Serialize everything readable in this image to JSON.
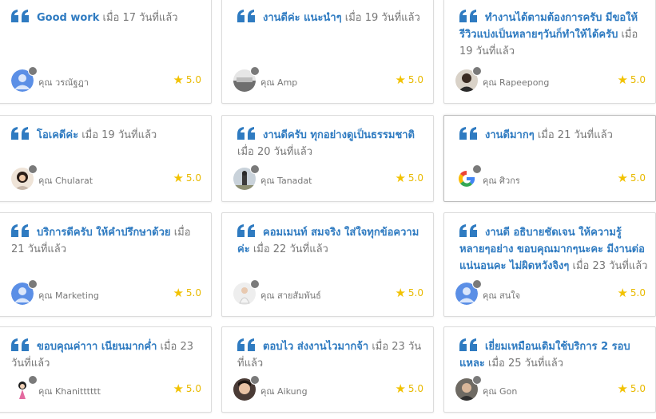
{
  "colors": {
    "accent": "#2f7bc1",
    "star": "#f2c200",
    "text": "#757575"
  },
  "reviews": [
    {
      "title": "Good work",
      "ago": "เมื่อ 17 วันที่แล้ว",
      "name": "คุณ วรณัฐฎา",
      "rating": "5.0",
      "avatar_icon": "person-avatar-icon"
    },
    {
      "title": "งานดีค่ะ แนะนำๆ",
      "ago": "เมื่อ 19 วันที่แล้ว",
      "name": "คุณ Amp",
      "rating": "5.0",
      "avatar_icon": "photo-avatar-icon"
    },
    {
      "title": "ทำงานได้ตามต้องการครับ มีขอให้รีวิวแบ่งเป็นหลายๆวันก็ทำให้ได้ครับ",
      "ago": "เมื่อ 19 วันที่แล้ว",
      "name": "คุณ Rapeepong",
      "rating": "5.0",
      "avatar_icon": "photo-avatar-icon"
    },
    {
      "title": "โอเคดีค่ะ",
      "ago": "เมื่อ 19 วันที่แล้ว",
      "name": "คุณ Chularat",
      "rating": "5.0",
      "avatar_icon": "photo-avatar-icon"
    },
    {
      "title": "งานดีครับ ทุกอย่างดูเป็นธรรมชาติ",
      "ago": "เมื่อ 20 วันที่แล้ว",
      "name": "คุณ Tanadat",
      "rating": "5.0",
      "avatar_icon": "photo-avatar-icon"
    },
    {
      "title": "งานดีมากๆ",
      "ago": "เมื่อ 21 วันที่แล้ว",
      "name": "คุณ ศิวกร",
      "rating": "5.0",
      "avatar_icon": "google-avatar-icon"
    },
    {
      "title": "บริการดีครับ ให้คำปรึกษาด้วย",
      "ago": "เมื่อ 21 วันที่แล้ว",
      "name": "คุณ Marketing",
      "rating": "5.0",
      "avatar_icon": "person-avatar-icon"
    },
    {
      "title": "คอมเมนท์ สมจริง ใส่ใจทุกข้อความค่ะ",
      "ago": "เมื่อ 22 วันที่แล้ว",
      "name": "คุณ สายสัมพันธ์",
      "rating": "5.0",
      "avatar_icon": "photo-avatar-icon"
    },
    {
      "title": "งานดี อธิบายชัดเจน ให้ความรู้หลายๆอย่าง ขอบคุณมากๆนะคะ มีงานต่อแน่นอนคะ ไม่ผิดหวังจิงๆ",
      "ago": "เมื่อ 23 วันที่แล้ว",
      "name": "คุณ สนใจ",
      "rating": "5.0",
      "avatar_icon": "person-avatar-icon"
    },
    {
      "title": "ขอบคุณค่าาา เนียนมากค่ำ",
      "ago": "เมื่อ 23 วันที่แล้ว",
      "name": "คุณ Khanitttttt",
      "rating": "5.0",
      "avatar_icon": "photo-avatar-icon"
    },
    {
      "title": "ตอบไว ส่งงานไวมากจ้า",
      "ago": "เมื่อ 23 วันที่แล้ว",
      "name": "คุณ Aikung",
      "rating": "5.0",
      "avatar_icon": "photo-avatar-icon"
    },
    {
      "title": "เยี่ยมเหมือนเดิมใช้บริการ 2 รอบแหละ",
      "ago": "เมื่อ 25 วันที่แล้ว",
      "name": "คุณ Gon",
      "rating": "5.0",
      "avatar_icon": "photo-avatar-icon"
    }
  ]
}
